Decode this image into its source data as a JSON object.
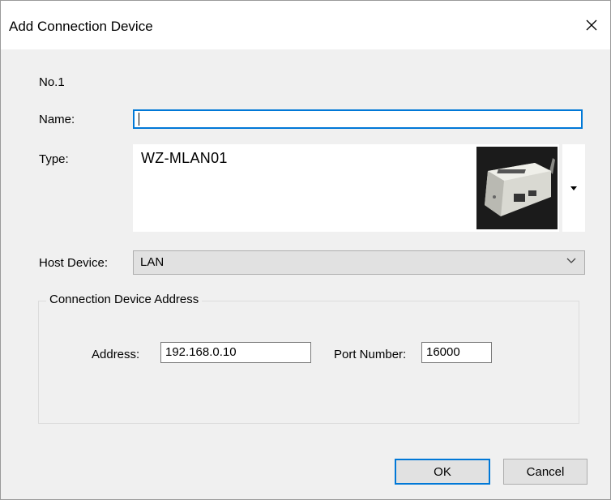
{
  "window": {
    "title": "Add Connection Device",
    "close_icon": "close-icon"
  },
  "form": {
    "number_label": "No.1",
    "name_label": "Name:",
    "name_value": "",
    "type_label": "Type:",
    "type_value": "WZ-MLAN01",
    "host_label": "Host Device:",
    "host_value": "LAN"
  },
  "group": {
    "title": "Connection Device Address",
    "address_label": "Address:",
    "address_value": "192.168.0.10",
    "port_label": "Port Number:",
    "port_value": "16000"
  },
  "buttons": {
    "ok": "OK",
    "cancel": "Cancel"
  },
  "colors": {
    "focus_border": "#0078d7",
    "dialog_bg": "#f0f0f0"
  }
}
